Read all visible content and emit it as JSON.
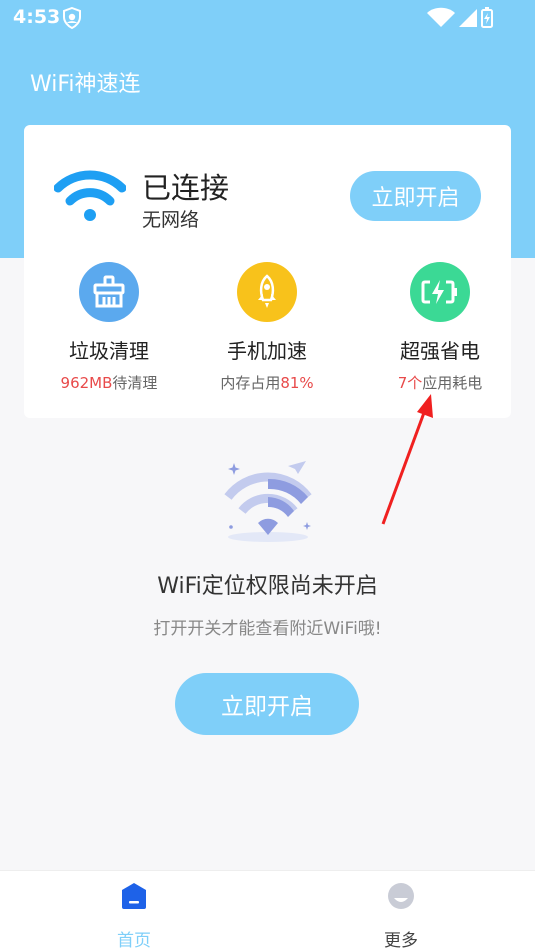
{
  "status_bar": {
    "time": "4:53"
  },
  "header": {
    "title": "WiFi神速连"
  },
  "connection": {
    "status": "已连接",
    "network": "无网络",
    "button_label": "立即开启"
  },
  "features": [
    {
      "title": "垃圾清理",
      "value": "962MB",
      "suffix": "待清理",
      "color": "#5ba9ee"
    },
    {
      "title": "手机加速",
      "prefix": "内存占用",
      "value": "81%",
      "color": "#f8c21b"
    },
    {
      "title": "超强省电",
      "value": "7个",
      "suffix": "应用耗电",
      "color": "#3bd995"
    }
  ],
  "permission": {
    "title": "WiFi定位权限尚未开启",
    "subtitle": "打开开关才能查看附近WiFi哦!",
    "button_label": "立即开启"
  },
  "bottom_nav": [
    {
      "label": "首页",
      "active": true,
      "color": "#7fcff9"
    },
    {
      "label": "更多",
      "active": false,
      "color": "#444444"
    }
  ],
  "colors": {
    "brand": "#7fcff9",
    "accent_blue": "#1e9ff3",
    "highlight_red": "#e84a4a"
  }
}
